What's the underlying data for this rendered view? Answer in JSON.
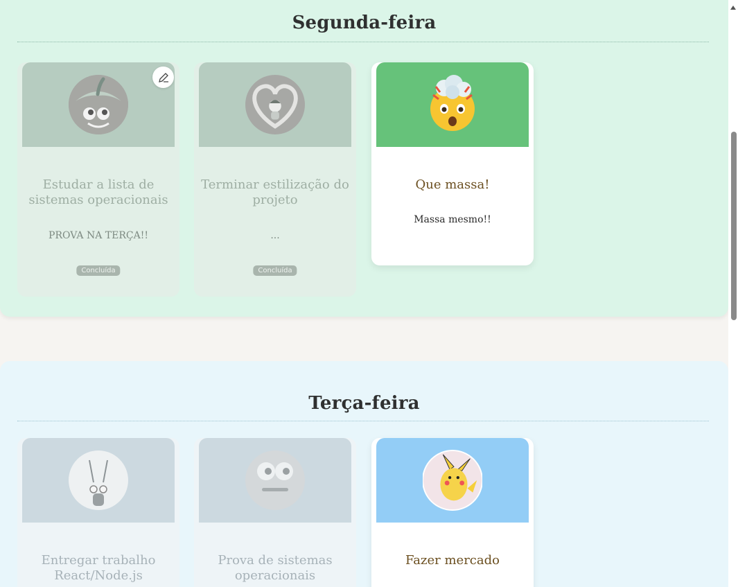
{
  "days": [
    {
      "name": "Segunda-feira",
      "cards": [
        {
          "title": "Estudar a lista de sistemas operacionais",
          "description": "PROVA NA TERÇA!!",
          "status": "Concluída",
          "icon": "apple-face-icon"
        },
        {
          "title": "Terminar estilização do projeto",
          "description": "...",
          "status": "Concluída",
          "icon": "heart-girl-icon"
        },
        {
          "title": "Que massa!",
          "description": "Massa mesmo!!",
          "icon": "exploding-head-emoji-icon"
        }
      ]
    },
    {
      "name": "Terça-feira",
      "cards": [
        {
          "title": "Entregar trabalho React/Node.js",
          "icon": "bug-character-icon"
        },
        {
          "title": "Prova de sistemas operacionais",
          "icon": "face-icon"
        },
        {
          "title": "Fazer mercado",
          "icon": "pikachu-icon"
        }
      ]
    }
  ],
  "colors": {
    "monday_bg": "#dbf5e8",
    "tuesday_bg": "#e8f6fb",
    "title_brown": "#6b4f20",
    "exploding_cover": "#66c27a",
    "pikachu_cover": "#93cdf6"
  }
}
